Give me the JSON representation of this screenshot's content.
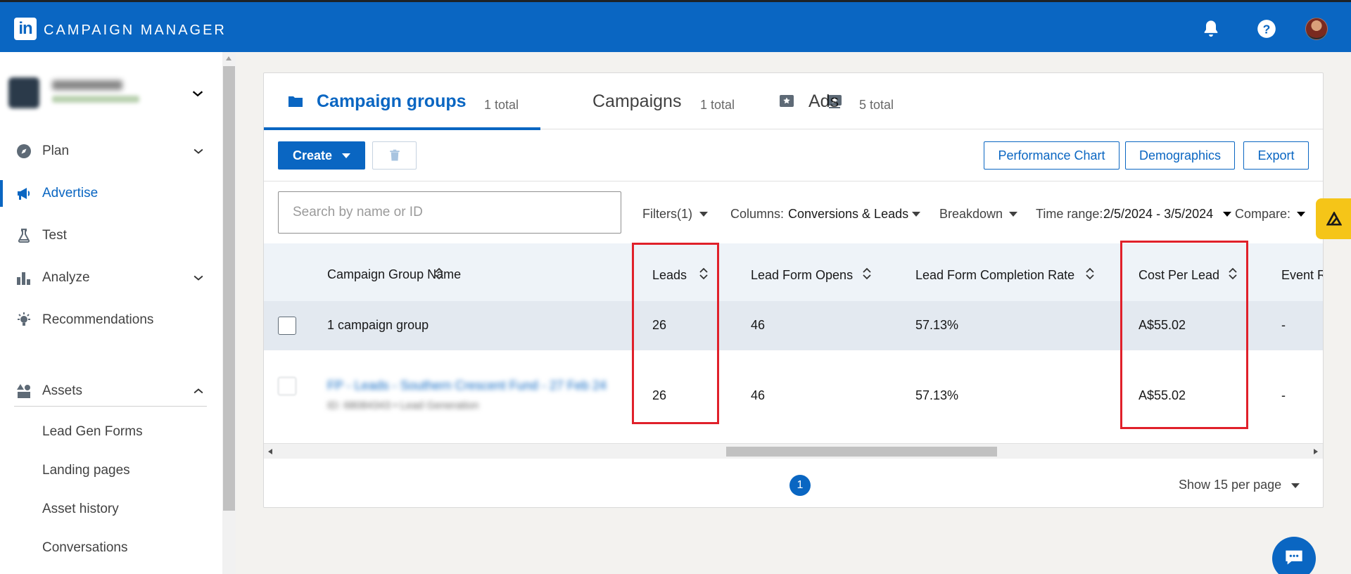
{
  "header": {
    "logo": "in",
    "brand": "CAMPAIGN MANAGER"
  },
  "sidebar": {
    "nav": [
      {
        "label": "Plan",
        "icon": "compass-icon",
        "chevron": "down"
      },
      {
        "label": "Advertise",
        "icon": "megaphone-icon",
        "active": true
      },
      {
        "label": "Test",
        "icon": "flask-icon"
      },
      {
        "label": "Analyze",
        "icon": "bar-chart-icon",
        "chevron": "down"
      },
      {
        "label": "Recommendations",
        "icon": "lightbulb-icon"
      }
    ],
    "assets": {
      "label": "Assets",
      "icon": "shapes-icon",
      "chevron": "up",
      "items": [
        "Lead Gen Forms",
        "Landing pages",
        "Asset history",
        "Conversations"
      ]
    }
  },
  "tabs": [
    {
      "label": "Campaign groups",
      "count": "1 total",
      "icon": "folder-icon",
      "active": true
    },
    {
      "label": "Campaigns",
      "count": "1 total",
      "icon": "campaign-icon"
    },
    {
      "label": "Ads",
      "count": "5 total",
      "icon": "ad-icon"
    }
  ],
  "toolbar": {
    "create_label": "Create",
    "performance_chart": "Performance Chart",
    "demographics": "Demographics",
    "export": "Export"
  },
  "filters": {
    "search_placeholder": "Search by name or ID",
    "filters_label": "Filters(1)",
    "columns_prefix": "Columns:",
    "columns_value": "Conversions & Leads",
    "breakdown": "Breakdown",
    "time_range_prefix": "Time range:",
    "time_range_value": "2/5/2024 - 3/5/2024",
    "compare": "Compare:"
  },
  "table": {
    "columns": [
      "Campaign Group Name",
      "Leads",
      "Lead Form Opens",
      "Lead Form Completion Rate",
      "Cost Per Lead",
      "Event R"
    ],
    "summary": {
      "name": "1 campaign group",
      "leads": "26",
      "opens": "46",
      "rate": "57.13%",
      "cpl": "A$55.02",
      "event": "-"
    },
    "rows": [
      {
        "name": "FP - Leads - Southern Crescent Fund - 27 Feb 24",
        "sub": "ID: 68084343 • Lead Generation",
        "leads": "26",
        "opens": "46",
        "rate": "57.13%",
        "cpl": "A$55.02",
        "event": "-"
      }
    ]
  },
  "pager": {
    "current_page": "1",
    "per_page": "Show 15 per page"
  },
  "colors": {
    "brand": "#0a66c2",
    "highlight": "#e0202a",
    "badge": "#f5c518"
  }
}
